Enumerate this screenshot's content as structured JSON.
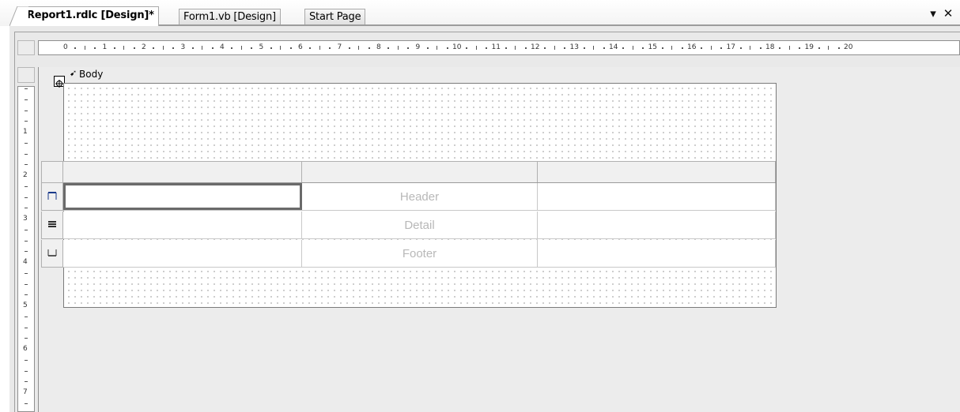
{
  "tabs": [
    {
      "label": "Report1.rdlc [Design]*",
      "active": true
    },
    {
      "label": "Form1.vb [Design]",
      "active": false
    },
    {
      "label": "Start Page",
      "active": false
    }
  ],
  "window_controls": {
    "dropdown_glyph": "▾",
    "close_glyph": "✕"
  },
  "ruler_horizontal": [
    "0",
    "1",
    "2",
    "3",
    "4",
    "5",
    "6",
    "7",
    "8",
    "9",
    "10",
    "11",
    "12",
    "13",
    "14",
    "15",
    "16",
    "17",
    "18",
    "19",
    "20"
  ],
  "ruler_vertical": [
    "1",
    "2",
    "3",
    "4",
    "5",
    "6",
    "7"
  ],
  "designer": {
    "section_label": "Body",
    "table": {
      "rows": [
        {
          "type": "header",
          "icon": "table-header-row-icon",
          "cells": [
            "",
            "Header",
            ""
          ]
        },
        {
          "type": "detail",
          "icon": "table-detail-row-icon",
          "cells": [
            "",
            "Detail",
            ""
          ]
        },
        {
          "type": "footer",
          "icon": "table-footer-row-icon",
          "cells": [
            "",
            "Footer",
            ""
          ]
        }
      ]
    }
  },
  "colors": {
    "accent_tab_border": "#a9a9a9",
    "canvas": "#ececec",
    "cell_text": "#b8b8b8"
  }
}
